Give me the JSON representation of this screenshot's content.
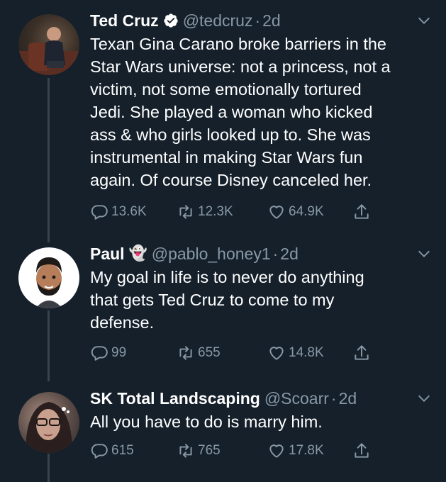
{
  "tweets": [
    {
      "name": "Ted Cruz",
      "verified": true,
      "handle": "@tedcruz",
      "time": "2d",
      "lines": [
        "Texan Gina Carano broke barriers in the",
        "Star Wars universe: not a princess, not a",
        "victim, not some emotionally tortured",
        "Jedi. She played a woman who kicked",
        "ass & who girls looked up to. She was",
        "instrumental in making Star Wars fun",
        "again. Of course Disney canceled her."
      ],
      "replies": "13.6K",
      "retweets": "12.3K",
      "likes": "64.9K"
    },
    {
      "name": "Paul",
      "emoji": "👻",
      "handle": "@pablo_honey1",
      "time": "2d",
      "lines": [
        "My goal in life is to never do anything",
        "that gets Ted Cruz to come to my",
        "defense."
      ],
      "replies": "99",
      "retweets": "655",
      "likes": "14.8K"
    },
    {
      "name": "SK Total Landscaping",
      "handle": "@Scoarr",
      "time": "2d",
      "lines": [
        "All you have to do is marry him."
      ],
      "replies": "615",
      "retweets": "765",
      "likes": "17.8K"
    }
  ],
  "colors": {
    "background": "#15202b",
    "secondary_text": "#8899a6",
    "thread_line": "#38444d",
    "verified": "#1da1f2"
  }
}
